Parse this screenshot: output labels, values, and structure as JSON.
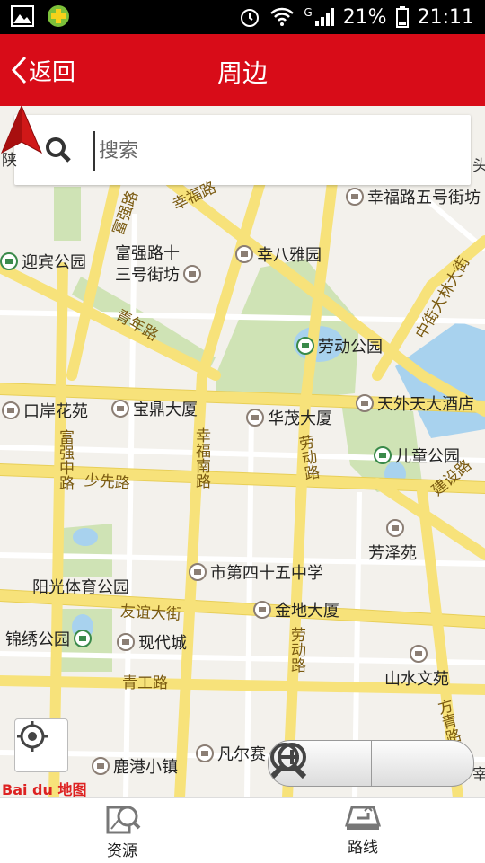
{
  "status": {
    "battery": "21%",
    "time": "21:11",
    "network": "G"
  },
  "header": {
    "back_label": "返回",
    "title": "周边"
  },
  "search": {
    "placeholder": "搜索"
  },
  "map": {
    "pois": [
      {
        "name": "幸福路五号街坊",
        "type": "building"
      },
      {
        "name": "富强路十",
        "type": "building"
      },
      {
        "name": "三号街坊",
        "type": "text"
      },
      {
        "name": "幸八雅园",
        "type": "building"
      },
      {
        "name": "迎宾公园",
        "type": "park"
      },
      {
        "name": "劳动公园",
        "type": "park"
      },
      {
        "name": "口岸花苑",
        "type": "building"
      },
      {
        "name": "宝鼎大厦",
        "type": "building"
      },
      {
        "name": "华茂大厦",
        "type": "building"
      },
      {
        "name": "天外天大酒店",
        "type": "hotel"
      },
      {
        "name": "儿童公园",
        "type": "park"
      },
      {
        "name": "芳泽苑",
        "type": "building"
      },
      {
        "name": "市第四十五中学",
        "type": "school"
      },
      {
        "name": "阳光体育公园",
        "type": "text"
      },
      {
        "name": "金地大厦",
        "type": "building"
      },
      {
        "name": "锦绣公园",
        "type": "park"
      },
      {
        "name": "现代城",
        "type": "building"
      },
      {
        "name": "山水文苑",
        "type": "building"
      },
      {
        "name": "鹿港小镇",
        "type": "building"
      },
      {
        "name": "凡尔赛",
        "type": "building"
      }
    ],
    "roads": [
      "幸福路",
      "富强路",
      "青年路",
      "中街大林大街",
      "富强中路",
      "少先路",
      "幸福南路",
      "劳动路",
      "建设路",
      "友谊大街",
      "青工路",
      "劳动路",
      "方青路"
    ],
    "edge_labels": [
      "陕",
      "头",
      "宰"
    ],
    "logo_text": "Bai du 地图"
  },
  "tabs": [
    {
      "label": "资源"
    },
    {
      "label": "路线"
    }
  ],
  "colors": {
    "header_bg": "#d80c18",
    "road": "#f7e27a",
    "park": "#cfe3b5",
    "water": "#a8d2ee",
    "location_arrow": "#d01818"
  }
}
